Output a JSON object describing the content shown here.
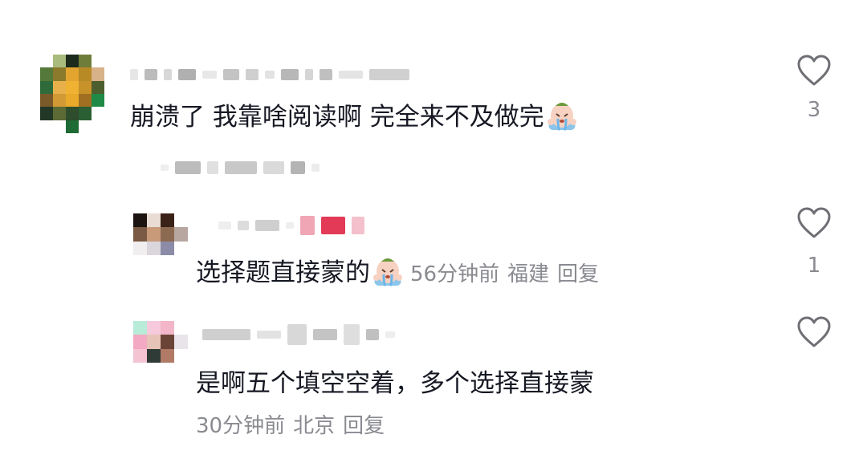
{
  "comments": [
    {
      "text": "崩溃了 我靠啥阅读啊 完全来不及做完",
      "emoji": "crying-face-emoji",
      "likes": "3"
    },
    {
      "text": "选择题直接蒙的",
      "emoji": "crying-face-emoji",
      "time": "56分钟前",
      "location": "福建",
      "reply": "回复",
      "likes": "1"
    },
    {
      "text": "是啊五个填空空着，多个选择直接蒙",
      "time": "30分钟前",
      "location": "北京",
      "reply": "回复",
      "likes": ""
    }
  ],
  "colors": {
    "text": "#161823",
    "meta": "#8a8b91",
    "heart": "#6f7075"
  }
}
